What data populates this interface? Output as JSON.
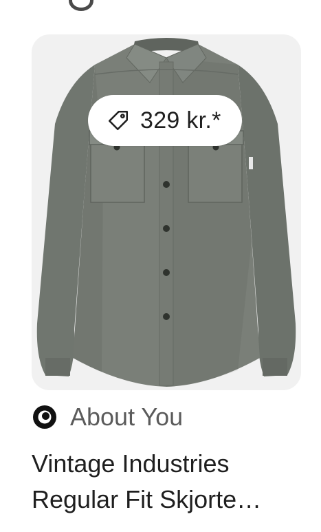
{
  "card": {
    "price": "329 kr.*",
    "price_icon": "tag-icon",
    "image_alt": "Grey long-sleeve button shirt with chest pockets"
  },
  "source": {
    "name": "About You",
    "icon": "about-you-logo"
  },
  "title": {
    "line1": "Vintage Industries",
    "line2": "Regular Fit Skjorte…"
  },
  "colors": {
    "card_bg": "#f1f1f1",
    "shirt": "#7a7f78",
    "text_primary": "#1f1f1f",
    "text_secondary": "#5b5b5b"
  }
}
